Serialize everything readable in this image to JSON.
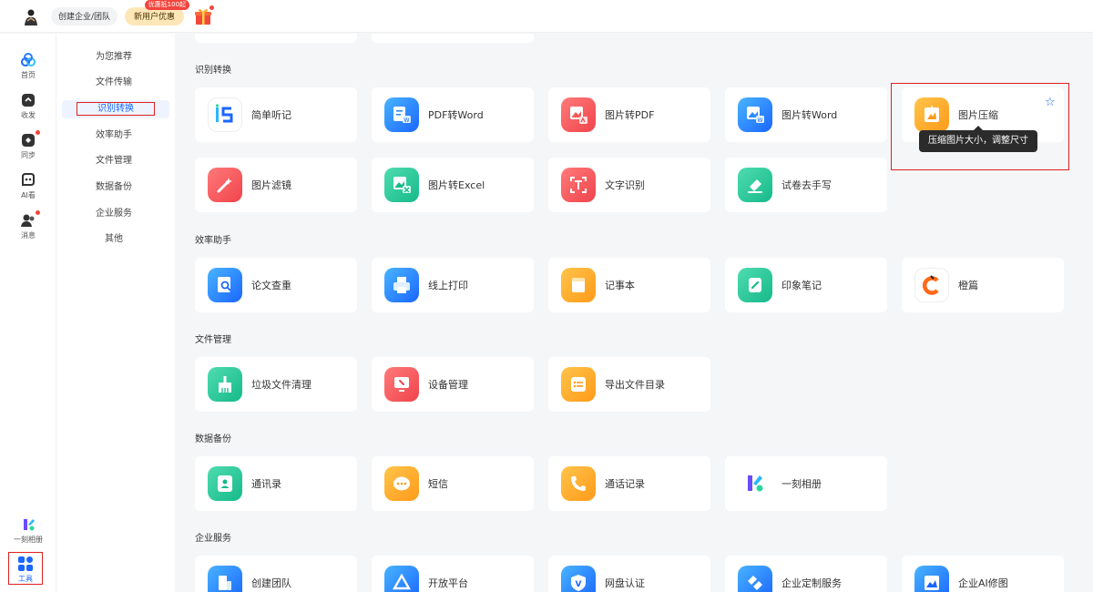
{
  "topbar": {
    "team_label": "创建企业/团队",
    "newuser_label": "新用户优惠",
    "newuser_tag": "优惠抵100起"
  },
  "iconbar": {
    "items": [
      {
        "label": "首页",
        "icon": "home-icon"
      },
      {
        "label": "收发",
        "icon": "send-receive-icon"
      },
      {
        "label": "同步",
        "icon": "sync-icon"
      },
      {
        "label": "AI看",
        "icon": "ai-view-icon"
      },
      {
        "label": "消息",
        "icon": "message-icon"
      }
    ],
    "bottom": [
      {
        "label": "一刻相册",
        "icon": "yike-album-icon"
      },
      {
        "label": "工具",
        "icon": "tools-icon"
      }
    ]
  },
  "categories": [
    "为您推荐",
    "文件传输",
    "识别转换",
    "效率助手",
    "文件管理",
    "数据备份",
    "企业服务",
    "其他"
  ],
  "active_category": "识别转换",
  "sections": [
    {
      "title": "识别转换",
      "rows": [
        [
          "简单听记",
          "PDF转Word",
          "图片转PDF",
          "图片转Word",
          "图片压缩"
        ],
        [
          "图片滤镜",
          "图片转Excel",
          "文字识别",
          "试卷去手写"
        ]
      ]
    },
    {
      "title": "效率助手",
      "rows": [
        [
          "论文查重",
          "线上打印",
          "记事本",
          "印象笔记",
          "橙篇"
        ]
      ]
    },
    {
      "title": "文件管理",
      "rows": [
        [
          "垃圾文件清理",
          "设备管理",
          "导出文件目录"
        ]
      ]
    },
    {
      "title": "数据备份",
      "rows": [
        [
          "通讯录",
          "短信",
          "通话记录",
          "一刻相册"
        ]
      ]
    },
    {
      "title": "企业服务",
      "rows": [
        [
          "创建团队",
          "开放平台",
          "网盘认证",
          "企业定制服务",
          "企业AI修图"
        ]
      ]
    }
  ],
  "tooltip": "压缩图片大小，调整尺寸",
  "colors": {
    "accent": "#1a66ff",
    "highlight": "#e02020"
  }
}
